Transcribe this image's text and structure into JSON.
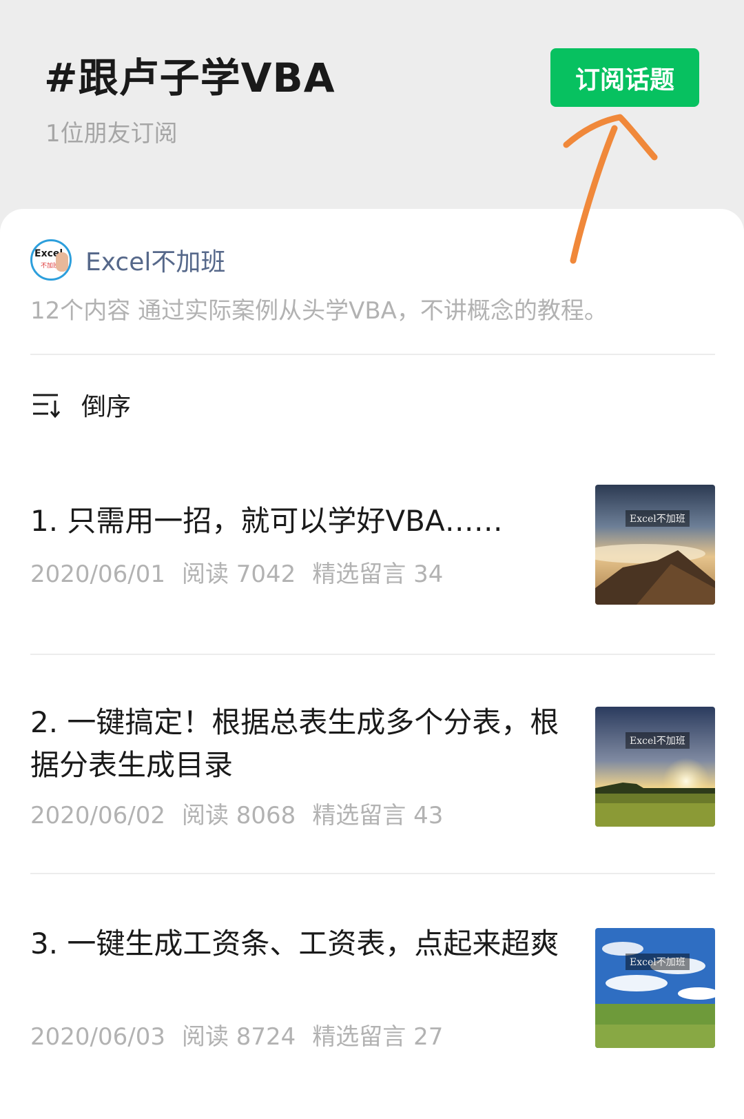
{
  "header": {
    "title": "#跟卢子学VBA",
    "subscriber_count": "1位朋友订阅",
    "subscribe_button": "订阅话题"
  },
  "author": {
    "name": "Excel不加班",
    "avatar_text": "Excel",
    "avatar_text2": "不加班"
  },
  "description": "12个内容 通过实际案例从头学VBA，不讲概念的教程。",
  "sort": {
    "label": "倒序",
    "icon": "sort-desc-icon"
  },
  "articles": [
    {
      "title": "1. 只需用一招，就可以学好VBA……",
      "date": "2020/06/01",
      "reads": "阅读 7042",
      "comments": "精选留言 34",
      "thumb_watermark": "Excel不加班"
    },
    {
      "title": "2. 一键搞定！根据总表生成多个分表，根据分表生成目录",
      "date": "2020/06/02",
      "reads": "阅读 8068",
      "comments": "精选留言 43",
      "thumb_watermark": "Excel不加班"
    },
    {
      "title": "3. 一键生成工资条、工资表，点起来超爽",
      "date": "2020/06/03",
      "reads": "阅读 8724",
      "comments": "精选留言 27",
      "thumb_watermark": "Excel不加班"
    }
  ],
  "colors": {
    "accent_green": "#07c160",
    "annotation_orange": "#f0883a"
  }
}
